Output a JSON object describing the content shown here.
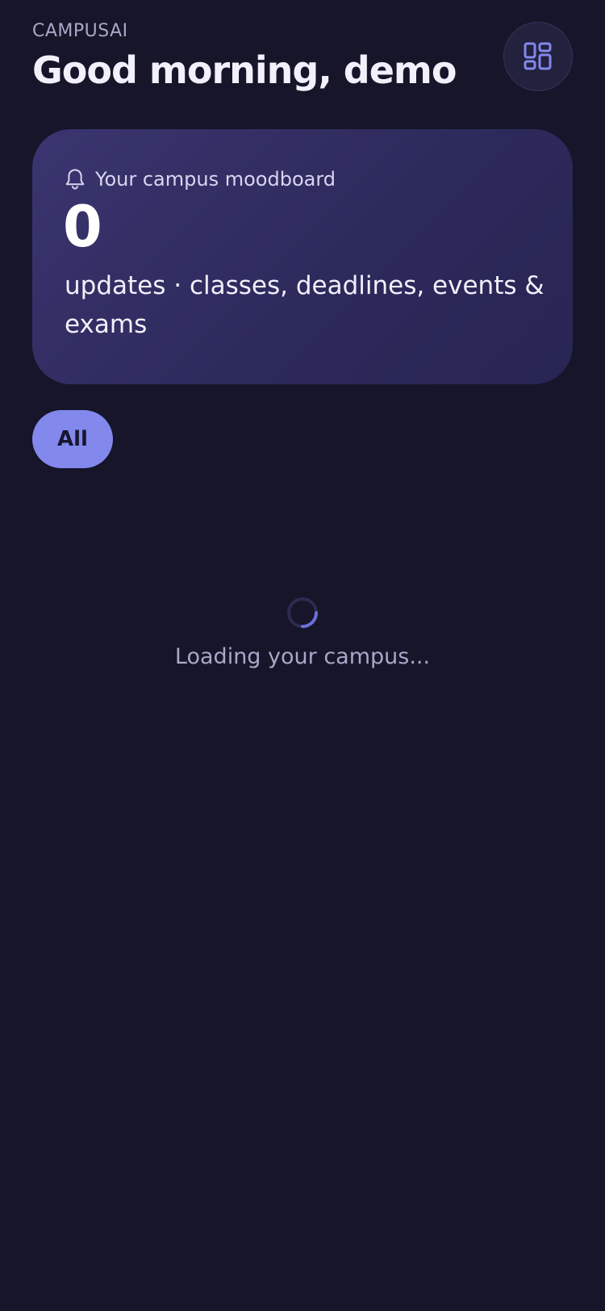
{
  "header": {
    "brand": "CAMPUSAI",
    "greeting": "Good morning, demo",
    "menu_icon": "grid-dashboard-icon"
  },
  "moodboard": {
    "icon": "bell-icon",
    "label": "Your campus moodboard",
    "count": "0",
    "description": "updates · classes, deadlines, events & exams"
  },
  "filters": {
    "active": "All"
  },
  "loading": {
    "text": "Loading your campus..."
  },
  "colors": {
    "background": "#161529",
    "card_gradient_start": "#3a356f",
    "card_gradient_end": "#282553",
    "accent": "#8388ec",
    "muted_text": "#a9a7c8"
  }
}
